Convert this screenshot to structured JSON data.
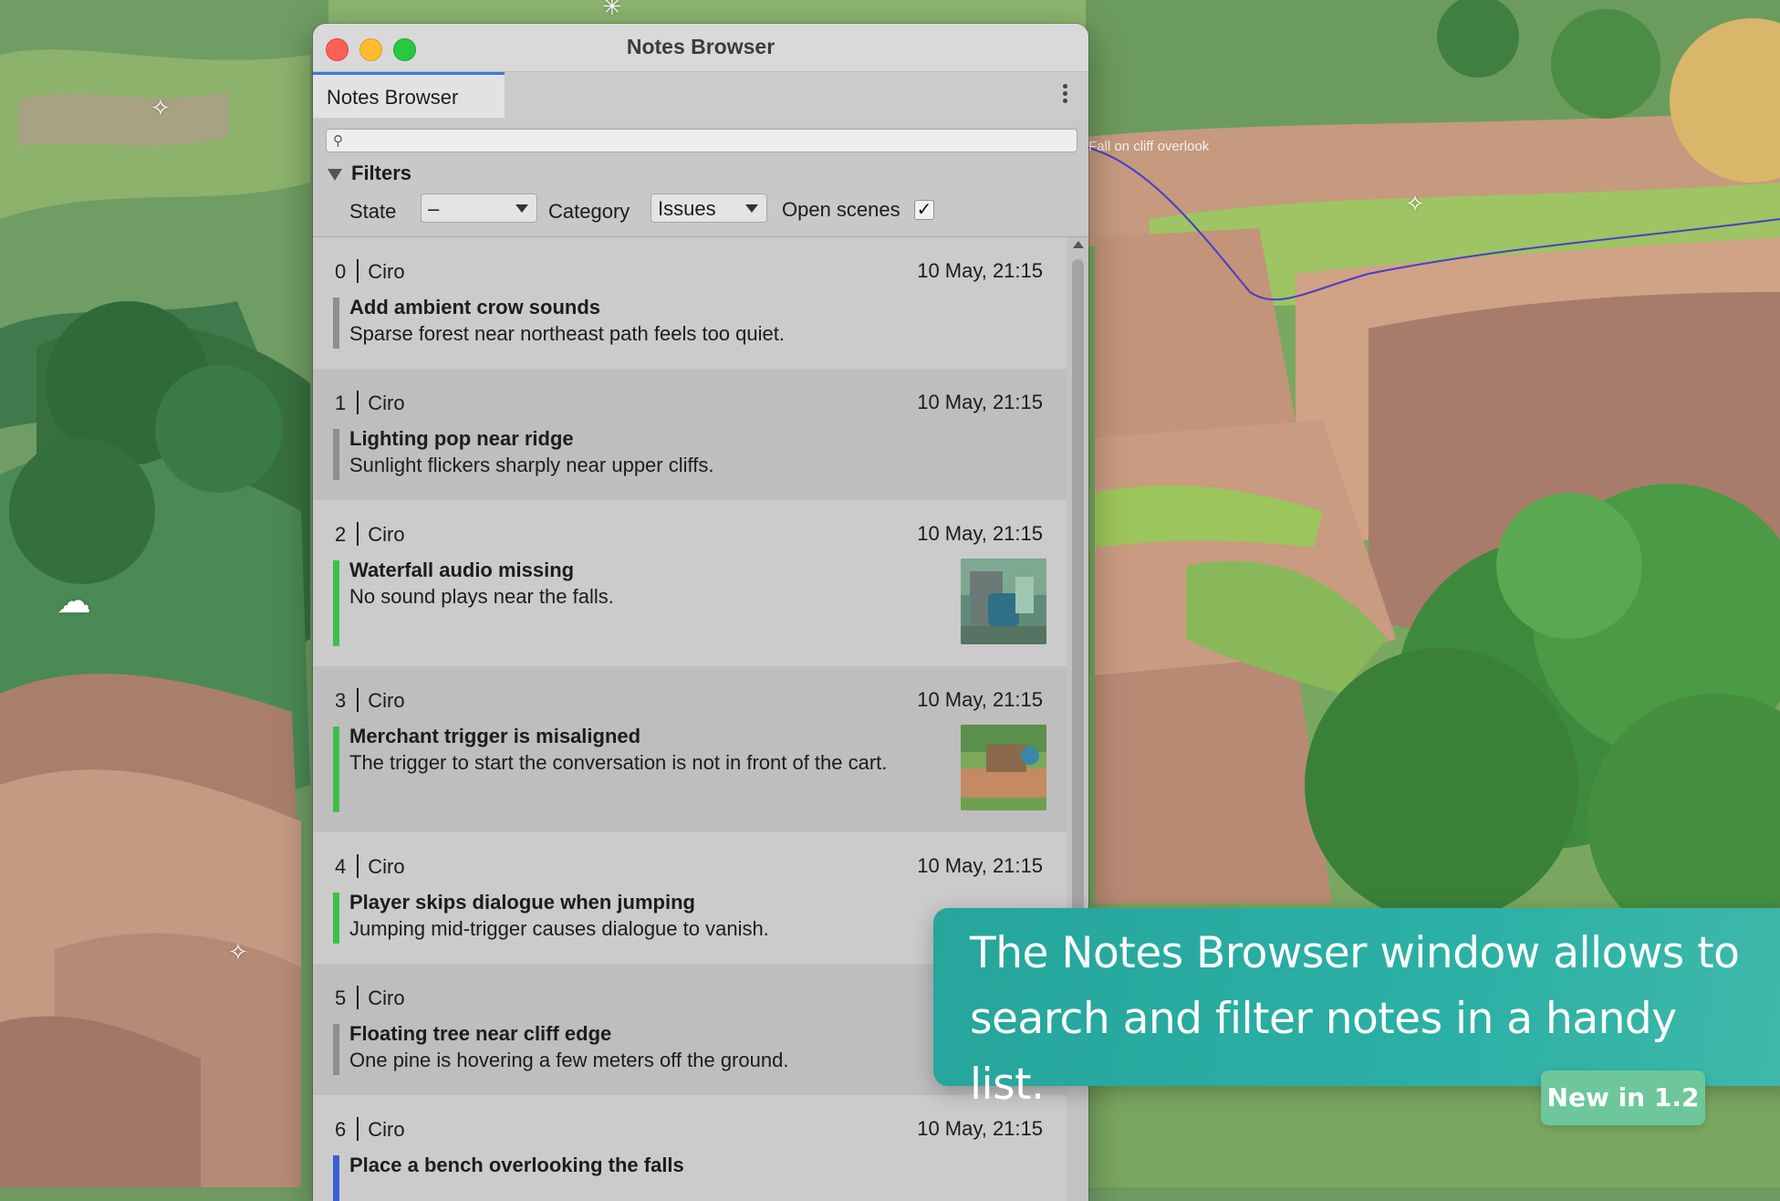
{
  "window": {
    "title": "Notes Browser",
    "tab_label": "Notes Browser"
  },
  "search": {
    "placeholder": ""
  },
  "filters": {
    "heading": "Filters",
    "state_label": "State",
    "state_value": "–",
    "category_label": "Category",
    "category_value": "Issues",
    "open_scenes_label": "Open scenes",
    "open_scenes_checked": "✓"
  },
  "notes": [
    {
      "index": "0",
      "author": "Ciro",
      "date": "10 May, 21:15",
      "title": "Add ambient crow sounds",
      "desc": "Sparse forest near northeast path feels too quiet.",
      "status_color": "#8e8e8e"
    },
    {
      "index": "1",
      "author": "Ciro",
      "date": "10 May, 21:15",
      "title": "Lighting pop near ridge",
      "desc": "Sunlight flickers sharply near upper cliffs.",
      "status_color": "#8e8e8e"
    },
    {
      "index": "2",
      "author": "Ciro",
      "date": "10 May, 21:15",
      "title": "Waterfall audio missing",
      "desc": "No sound plays near the falls.",
      "status_color": "#3fbe4a"
    },
    {
      "index": "3",
      "author": "Ciro",
      "date": "10 May, 21:15",
      "title": "Merchant trigger is misaligned",
      "desc": "The trigger to start the conversation is not in front of the cart.",
      "status_color": "#3fbe4a"
    },
    {
      "index": "4",
      "author": "Ciro",
      "date": "10 May, 21:15",
      "title": "Player skips dialogue when jumping",
      "desc": "Jumping mid-trigger causes dialogue to vanish.",
      "status_color": "#3fbe4a"
    },
    {
      "index": "5",
      "author": "Ciro",
      "date": "10",
      "title": "Floating tree near cliff edge",
      "desc": "One pine is hovering a few meters off the ground.",
      "status_color": "#8e8e8e"
    },
    {
      "index": "6",
      "author": "Ciro",
      "date": "10 May, 21:15",
      "title": "Place a bench overlooking the falls",
      "desc": "",
      "status_color": "#3a5fd4"
    }
  ],
  "scene": {
    "path_label": "Fall on cliff overlook"
  },
  "banner": {
    "line1": "The Notes Browser window allows to",
    "line2": "search and filter notes in a handy list.",
    "badge": "New in 1.2"
  }
}
